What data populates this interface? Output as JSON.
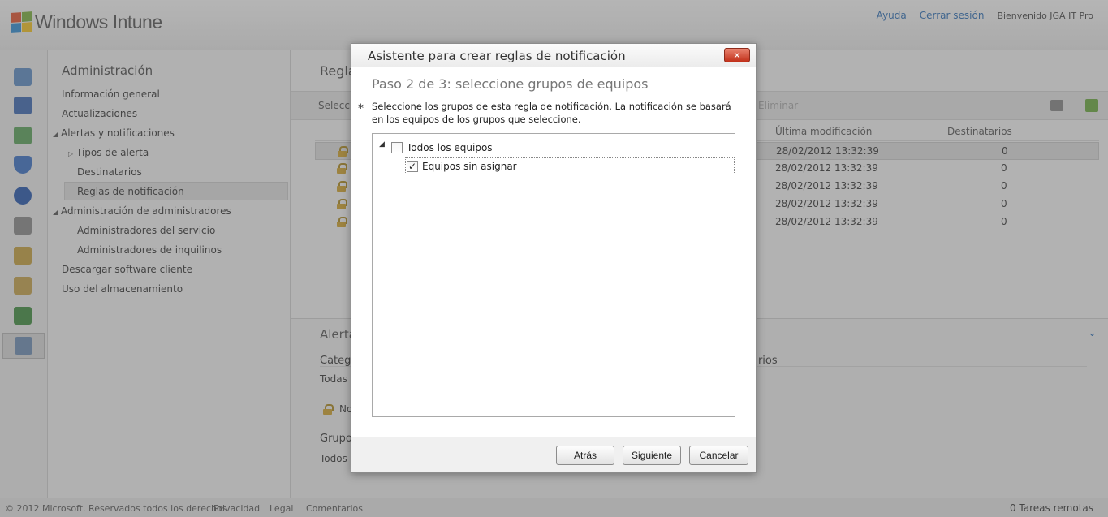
{
  "header": {
    "app_name": "Windows Intune",
    "links": {
      "help": "Ayuda",
      "signout": "Cerrar sesión"
    },
    "welcome": "Bienvenido JGA IT Pro"
  },
  "rail": {
    "icons": [
      "system-overview-icon",
      "groups-icon",
      "updates-icon",
      "endpoint-protection-icon",
      "alerts-icon",
      "software-icon",
      "licenses-icon",
      "reports-icon",
      "policy-icon",
      "administration-icon"
    ],
    "colors": [
      "#5b8cc7",
      "#3b69b5",
      "#5aa55a",
      "#3a72c9",
      "#2356b0",
      "#8a8a8a",
      "#c8a23c",
      "#c9a54a",
      "#3e8f3e",
      "#6d8fb6"
    ]
  },
  "nav": {
    "title": "Administración",
    "items": [
      {
        "label": "Información general"
      },
      {
        "label": "Actualizaciones"
      },
      {
        "label": "Alertas y notificaciones"
      },
      {
        "label": "Tipos de alerta"
      },
      {
        "label": "Destinatarios"
      },
      {
        "label": "Reglas de notificación"
      },
      {
        "label": "Administración de administradores"
      },
      {
        "label": "Administradores del servicio"
      },
      {
        "label": "Administradores de inquilinos"
      },
      {
        "label": "Descargar software cliente"
      },
      {
        "label": "Uso del almacenamiento"
      }
    ]
  },
  "main": {
    "title": "Regla",
    "toolbar": {
      "select_label": "Seleccio",
      "delete_label": "Eliminar"
    },
    "columns": {
      "modified": "Última modificación",
      "recipients": "Destinatarios"
    },
    "rows": [
      {
        "modified": "28/02/2012 13:32:39",
        "recipients": "0"
      },
      {
        "modified": "28/02/2012 13:32:39",
        "recipients": "0"
      },
      {
        "modified": "28/02/2012 13:32:39",
        "recipients": "0"
      },
      {
        "modified": "28/02/2012 13:32:39",
        "recipients": "0"
      },
      {
        "modified": "28/02/2012 13:32:39",
        "recipients": "0"
      }
    ],
    "details": {
      "title": "Alerta",
      "category_label": "Catego",
      "recipients_label": "arios",
      "all_label": "Todas l",
      "rule_label": "No",
      "group_label": "Grupo",
      "all_groups_label": "Todos"
    }
  },
  "dialog": {
    "title": "Asistente para crear reglas de notificación",
    "close_label": "✕",
    "step": "Paso 2 de 3: seleccione grupos de equipos",
    "required_mark": "*",
    "instructions": "Seleccione los grupos de esta regla de notificación. La notificación se basará en los equipos de los grupos que seleccione.",
    "tree": {
      "expander": "◢",
      "root": {
        "label": "Todos los equipos",
        "checked": false
      },
      "child": {
        "label": "Equipos sin asignar",
        "checked": true,
        "check_mark": "✓"
      }
    },
    "buttons": {
      "back": "Atrás",
      "next": "Siguiente",
      "cancel": "Cancelar"
    }
  },
  "footer": {
    "copyright": "© 2012 Microsoft. Reservados todos los derechos",
    "privacy": "Privacidad",
    "legal": "Legal",
    "feedback": "Comentarios",
    "remote_tasks": "0 Tareas remotas"
  }
}
